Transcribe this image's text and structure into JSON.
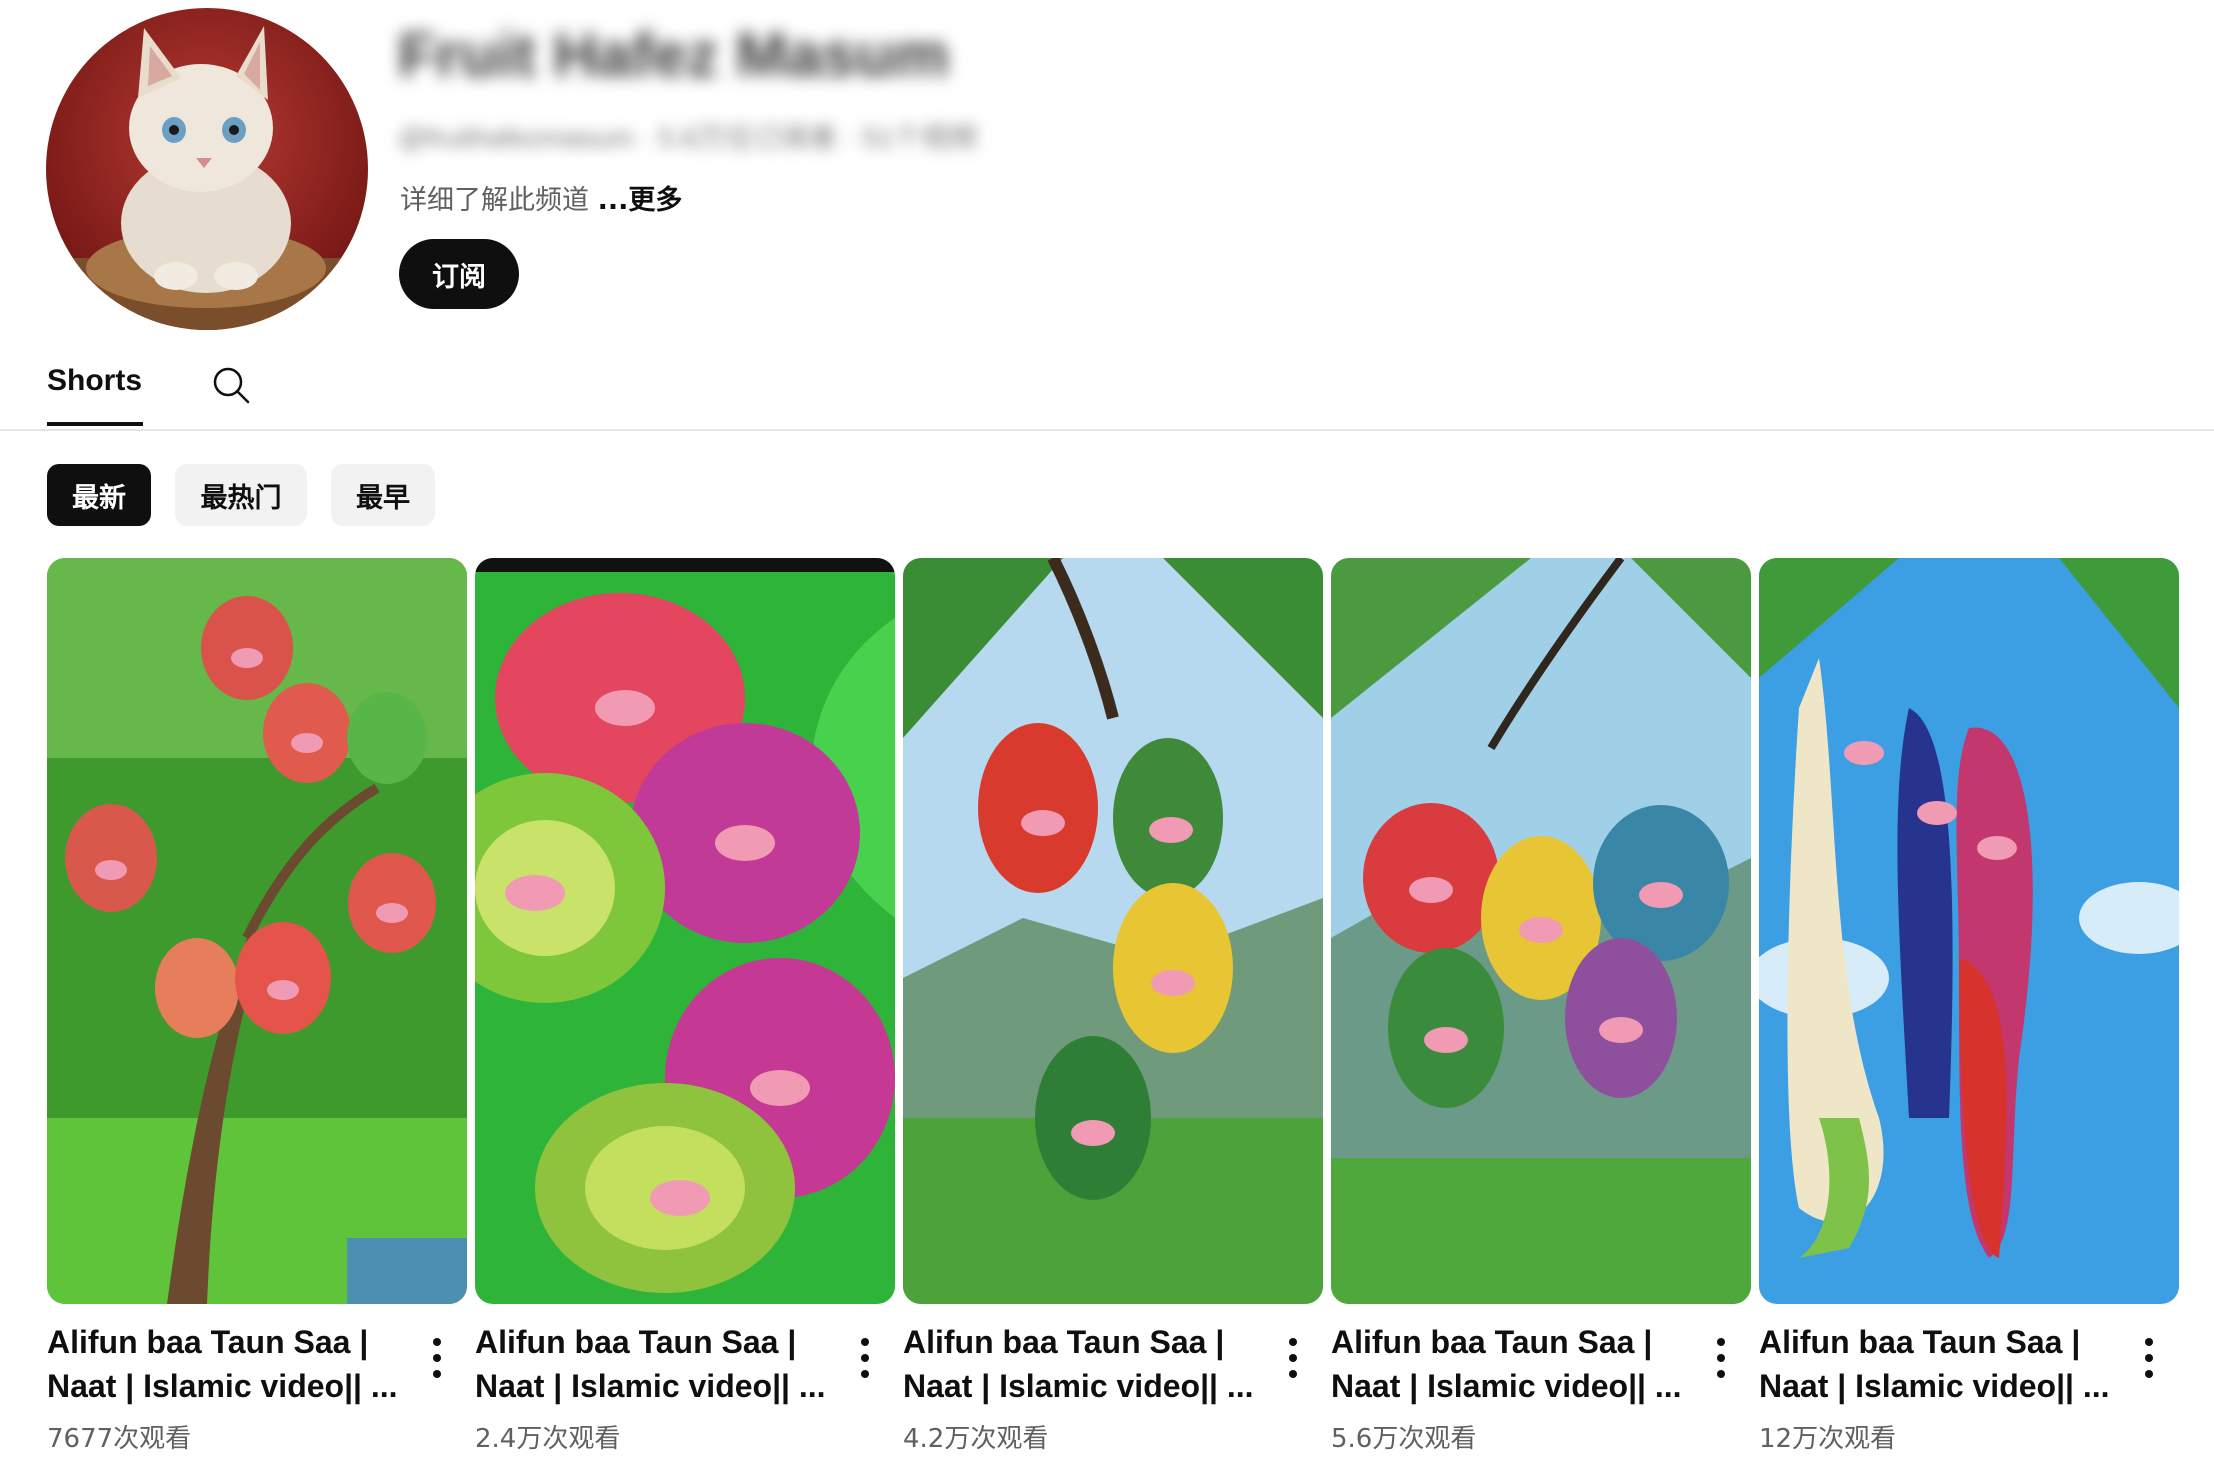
{
  "channel": {
    "name": "Fruit Hafez Masum",
    "meta": "@fruithafezmasum · 5.6万位订阅者 · 51个视频",
    "description": "详细了解此频道",
    "more_label": "...更多",
    "subscribe_label": "订阅"
  },
  "tabs": [
    {
      "label": "Shorts",
      "active": true
    }
  ],
  "search_icon": "search-icon",
  "chips": [
    {
      "label": "最新",
      "active": true
    },
    {
      "label": "最热门",
      "active": false
    },
    {
      "label": "最早",
      "active": false
    }
  ],
  "videos": [
    {
      "title": "Alifun baa Taun Saa | Naat | Islamic video|| ...",
      "views": "7677次观看"
    },
    {
      "title": "Alifun baa Taun Saa | Naat | Islamic video|| ...",
      "views": "2.4万次观看"
    },
    {
      "title": "Alifun baa Taun Saa | Naat | Islamic video|| ...",
      "views": "4.2万次观看"
    },
    {
      "title": "Alifun baa Taun Saa | Naat | Islamic video|| ...",
      "views": "5.6万次观看"
    },
    {
      "title": "Alifun baa Taun Saa | Naat | Islamic video|| ...",
      "views": "12万次观看"
    }
  ],
  "colors": {
    "text_primary": "#0f0f0f",
    "text_secondary": "#606060",
    "chip_bg": "#f2f2f2",
    "active_bg": "#0f0f0f"
  }
}
